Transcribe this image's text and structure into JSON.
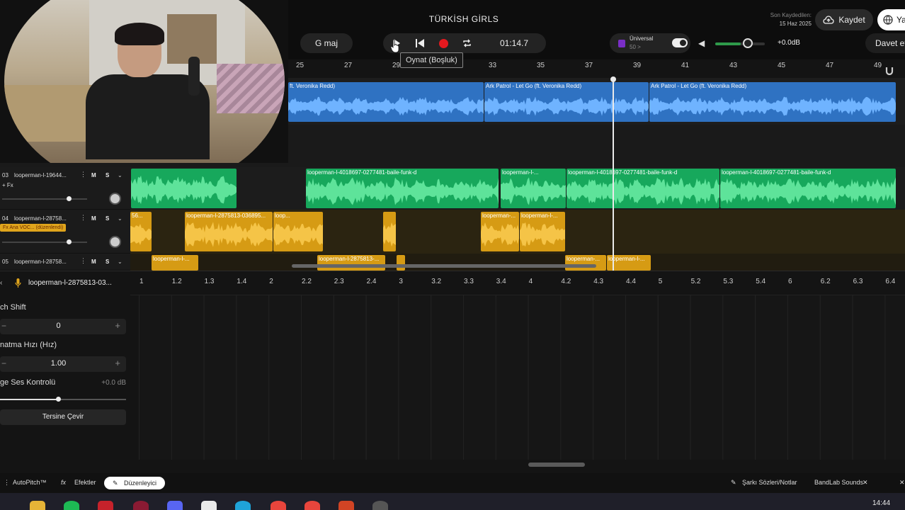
{
  "header": {
    "song_title": "TÜRKİSH GİRLS",
    "key": "G maj",
    "time": "01:14.7",
    "tooltip": "Oynat (Boşluk)",
    "metronome_name": "Üniversal",
    "metronome_bpm": "50 >",
    "master_db": "+0.0dB",
    "last_saved_label": "Son Kaydedilen:",
    "last_saved_date": "15 Haz 2025",
    "save_label": "Kaydet",
    "lang_label": "Ya",
    "invite_label": "Davet et",
    "master_level": 0.52
  },
  "ruler": {
    "bars": [
      "25",
      "27",
      "29",
      "31",
      "33",
      "35",
      "37",
      "39",
      "41",
      "43",
      "45",
      "47",
      "49"
    ]
  },
  "tracks": [
    {
      "number": "03",
      "name": "looperman-l-19644...",
      "fx_label": "+ Fx",
      "m": "M",
      "s": "S",
      "volume": 0.78,
      "clips": [
        "looperman-l-4018697-0277481-baile-funk-d",
        "looperman-l-...",
        "looperman-l-4018697-0277481-baile-funk-d",
        "looperman-l-4018697-0277481-baile-funk-d"
      ]
    },
    {
      "number": "04",
      "name": "looperman-l-28758...",
      "tag": "Fx Ana VOC... (düzenlendi)",
      "m": "M",
      "s": "S",
      "volume": 0.78,
      "clips": [
        "56...",
        "looperman-l-2875813-036895...",
        "loop...",
        "looperman-...",
        "looperman-l-..."
      ]
    },
    {
      "number": "05",
      "name": "looperman-l-28758...",
      "m": "M",
      "s": "S",
      "clips": [
        "looperman-l-...",
        "looperman-l-2875813-...",
        "looperman-...",
        "looperman-l-..."
      ]
    }
  ],
  "top_clips": [
    "ft. Veronika Redd)",
    "Ark Patrol - Let Go (ft. Veronika Redd)",
    "Ark Patrol - Let Go (ft. Veronika Redd)"
  ],
  "editor": {
    "clip_name": "looperman-l-2875813-03...",
    "beats": [
      "1",
      "1.2",
      "1.3",
      "1.4",
      "2",
      "2.2",
      "2.3",
      "2.4",
      "3",
      "3.2",
      "3.3",
      "3.4",
      "4",
      "4.2",
      "4.3",
      "4.4",
      "5",
      "5.2",
      "5.3",
      "5.4",
      "6",
      "6.2",
      "6.3",
      "6.4"
    ],
    "pitch_label": "ch Shift",
    "pitch_value": "0",
    "rate_label": "natma Hızı (Hız)",
    "rate_value": "1.00",
    "gain_label": "ge Ses Kontrolü",
    "gain_db": "+0.0 dB",
    "gain_level": 0.46,
    "reverse_label": "Tersine Çevir"
  },
  "bottombar": {
    "autopitch": "AutoPitch™",
    "effects": "Efektler",
    "editor": "Düzenleyici",
    "lyrics": "Şarkı Sözleri/Notlar",
    "sounds": "BandLab Sounds"
  },
  "taskbar": {
    "clock": "14:44"
  },
  "colors": {
    "blue_clip": "#2f72c2",
    "green_clip": "#17a85c",
    "yellow_clip": "#d69b14",
    "record": "#e5191f"
  }
}
